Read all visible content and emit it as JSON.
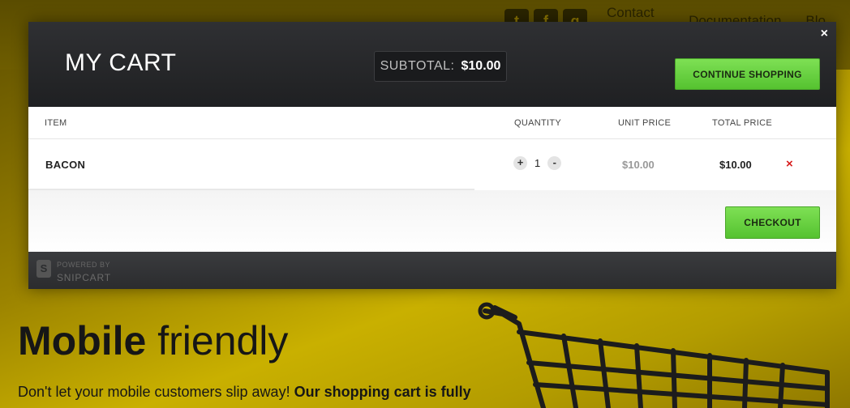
{
  "background_page": {
    "nav": {
      "social": [
        {
          "icon": "twitter-icon",
          "glyph": "t"
        },
        {
          "icon": "facebook-icon",
          "glyph": "f"
        },
        {
          "icon": "github-icon",
          "glyph": "g"
        }
      ],
      "links": [
        "Contact Us",
        "Documentation",
        "Blo"
      ]
    },
    "heading_bold": "Mobile",
    "heading_light": "friendly",
    "paragraph_normal": "Don't let your mobile customers slip away!",
    "paragraph_bold": "Our shopping cart is fully"
  },
  "cart": {
    "close_label": "×",
    "title": "MY CART",
    "subtotal_label": "SUBTOTAL:",
    "subtotal_value": "$10.00",
    "continue_label": "CONTINUE SHOPPING",
    "columns": {
      "item": "ITEM",
      "quantity": "QUANTITY",
      "unit_price": "UNIT PRICE",
      "total_price": "TOTAL PRICE"
    },
    "items": [
      {
        "name": "BACON",
        "quantity": "1",
        "plus": "+",
        "minus": "-",
        "unit_price": "$10.00",
        "total_price": "$10.00",
        "remove": "×"
      }
    ],
    "checkout_label": "CHECKOUT",
    "powered_by": "POWERED BY",
    "brand": "SNIPCART",
    "logo_glyph": "S"
  },
  "colors": {
    "accent_green": "#66cc33",
    "remove_red": "#d71c1c",
    "page_yellow": "#c9b000"
  }
}
